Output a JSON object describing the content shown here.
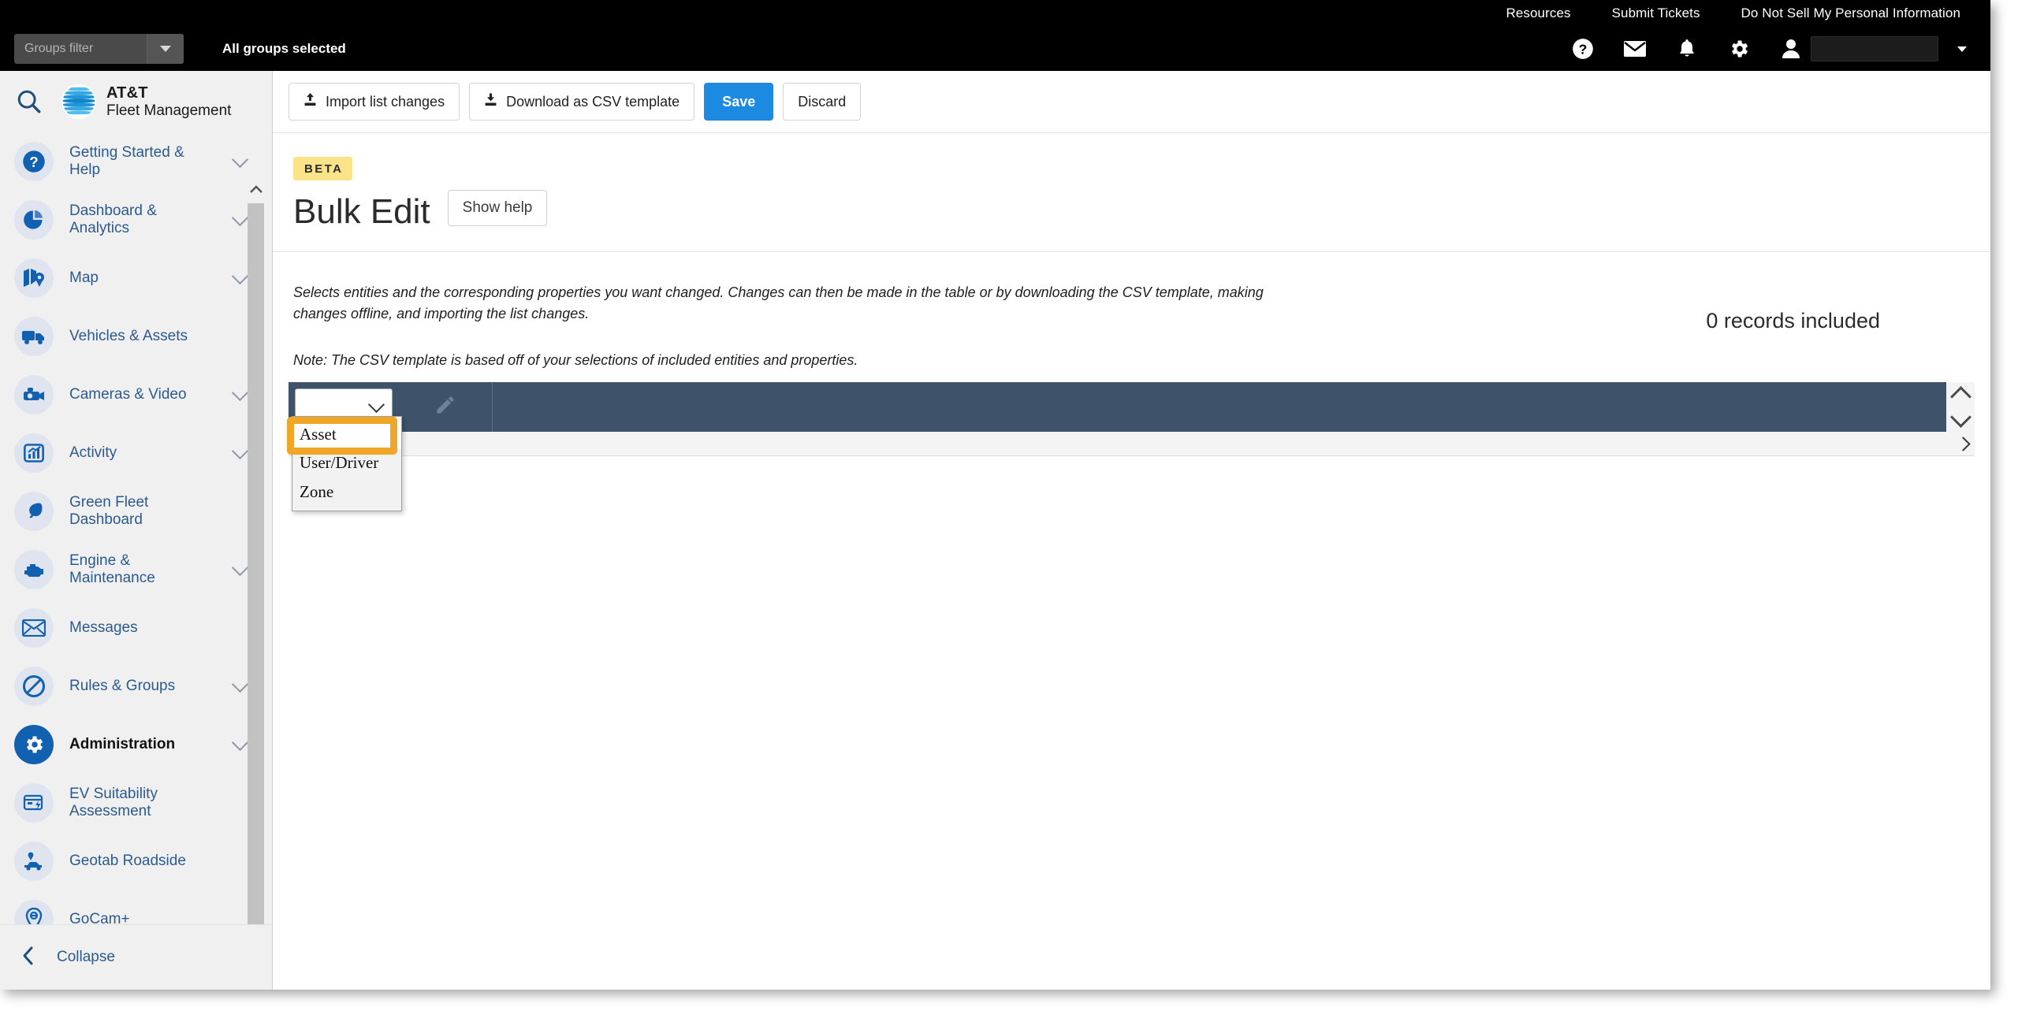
{
  "top_links": [
    {
      "label": "Resources",
      "name": "resources-link"
    },
    {
      "label": "Submit Tickets",
      "name": "submit-tickets-link"
    },
    {
      "label": "Do Not Sell My Personal Information",
      "name": "do-not-sell-link"
    }
  ],
  "groups_bar": {
    "filter_placeholder": "Groups filter",
    "filter_value": "",
    "status": "All groups selected"
  },
  "header_icons": [
    {
      "name": "help-icon",
      "glyph": "?"
    },
    {
      "name": "mail-icon",
      "glyph": "mail"
    },
    {
      "name": "notifications-bell-icon",
      "glyph": "bell"
    },
    {
      "name": "settings-gear-icon",
      "glyph": "gear"
    },
    {
      "name": "user-account-icon",
      "glyph": "person"
    }
  ],
  "brand": {
    "line1": "AT&T",
    "line2": "Fleet Management"
  },
  "sidebar": {
    "search_label": "Search",
    "items": [
      {
        "label": "Getting Started & Help",
        "icon": "question-circle-icon",
        "expandable": true,
        "active": false
      },
      {
        "label": "Dashboard & Analytics",
        "icon": "pie-chart-icon",
        "expandable": true,
        "active": false
      },
      {
        "label": "Map",
        "icon": "map-pin-icon",
        "expandable": true,
        "active": false
      },
      {
        "label": "Vehicles & Assets",
        "icon": "truck-icon",
        "expandable": false,
        "active": false
      },
      {
        "label": "Cameras & Video",
        "icon": "dashcam-icon",
        "expandable": true,
        "active": false
      },
      {
        "label": "Activity",
        "icon": "bar-chart-icon",
        "expandable": true,
        "active": false
      },
      {
        "label": "Green Fleet Dashboard",
        "icon": "leaf-icon",
        "expandable": false,
        "active": false
      },
      {
        "label": "Engine & Maintenance",
        "icon": "engine-icon",
        "expandable": true,
        "active": false
      },
      {
        "label": "Messages",
        "icon": "envelope-icon",
        "expandable": false,
        "active": false
      },
      {
        "label": "Rules & Groups",
        "icon": "no-entry-icon",
        "expandable": true,
        "active": false
      },
      {
        "label": "Administration",
        "icon": "gear-icon",
        "expandable": true,
        "active": true
      },
      {
        "label": "EV Suitability Assessment",
        "icon": "ev-card-icon",
        "expandable": false,
        "active": false
      },
      {
        "label": "Geotab Roadside",
        "icon": "roadside-car-icon",
        "expandable": false,
        "active": false
      },
      {
        "label": "GoCam+",
        "icon": "gocam-pin-icon",
        "expandable": false,
        "active": false
      }
    ],
    "collapse_label": "Collapse"
  },
  "toolbar": {
    "import_label": "Import list changes",
    "download_label": "Download as CSV template",
    "save_label": "Save",
    "discard_label": "Discard"
  },
  "page_header": {
    "badge": "BETA",
    "title": "Bulk Edit",
    "show_help_label": "Show help"
  },
  "description": {
    "paragraph": "Selects entities and the corresponding properties you want changed. Changes can then be made in the table or by downloading the CSV template, making changes offline, and importing the list changes.",
    "note": "Note: The CSV template is based off of your selections of included entities and properties."
  },
  "records_included": "0 records included",
  "table": {
    "entity_select_value": "",
    "edit_icon": "pencil-icon",
    "dropdown_open": true,
    "options": [
      {
        "label": "Asset",
        "selected": true
      },
      {
        "label": "User/Driver",
        "selected": false
      },
      {
        "label": "Zone",
        "selected": false
      }
    ]
  },
  "colors": {
    "header_bar": "#000000",
    "accent_blue": "#1b8ae0",
    "table_header": "#3e5369",
    "beta_badge": "#fbe38a",
    "highlight": "#f0a626",
    "sidebar_bg": "#f0f0f0",
    "nav_link": "#2d5a8e"
  }
}
